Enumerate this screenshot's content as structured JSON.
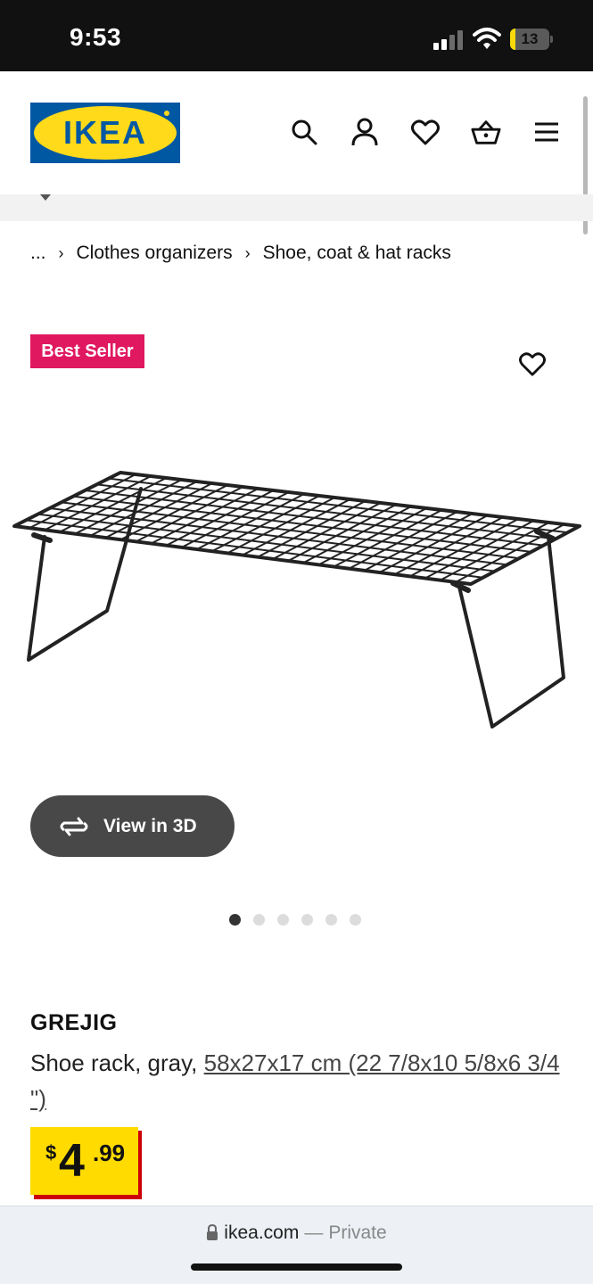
{
  "status_bar": {
    "time": "9:53",
    "battery_level": 13,
    "battery_label": "13",
    "icons": [
      "cellular-signal-icon",
      "wifi-icon",
      "battery-icon"
    ]
  },
  "header": {
    "logo_text": "IKEA",
    "logo_colors": {
      "background": "#0058a3",
      "ellipse": "#ffda1a",
      "text": "#0058a3"
    },
    "icons": [
      "search-icon",
      "account-icon",
      "favourites-heart-icon",
      "shopping-basket-icon",
      "menu-icon"
    ]
  },
  "breadcrumb": {
    "items": [
      "...",
      "Clothes organizers",
      "Shoe, coat & hat racks"
    ],
    "separator": "›"
  },
  "product": {
    "badge": "Best Seller",
    "badge_color": "#e0185f",
    "view_3d_label": "View in 3D",
    "image_count": 6,
    "active_image_index": 0,
    "name": "GREJIG",
    "description_prefix": "Shoe rack, gray, ",
    "dimensions_link": "58x27x17 cm (22 7/8x10 5/8x6 3/4 \")",
    "price": {
      "currency": "$",
      "integer": "4",
      "decimal": ".99",
      "box_color": "#ffdb00",
      "shadow_color": "#cc0008"
    }
  },
  "browser": {
    "url": "ikea.com",
    "separator": "—",
    "mode": "Private"
  }
}
